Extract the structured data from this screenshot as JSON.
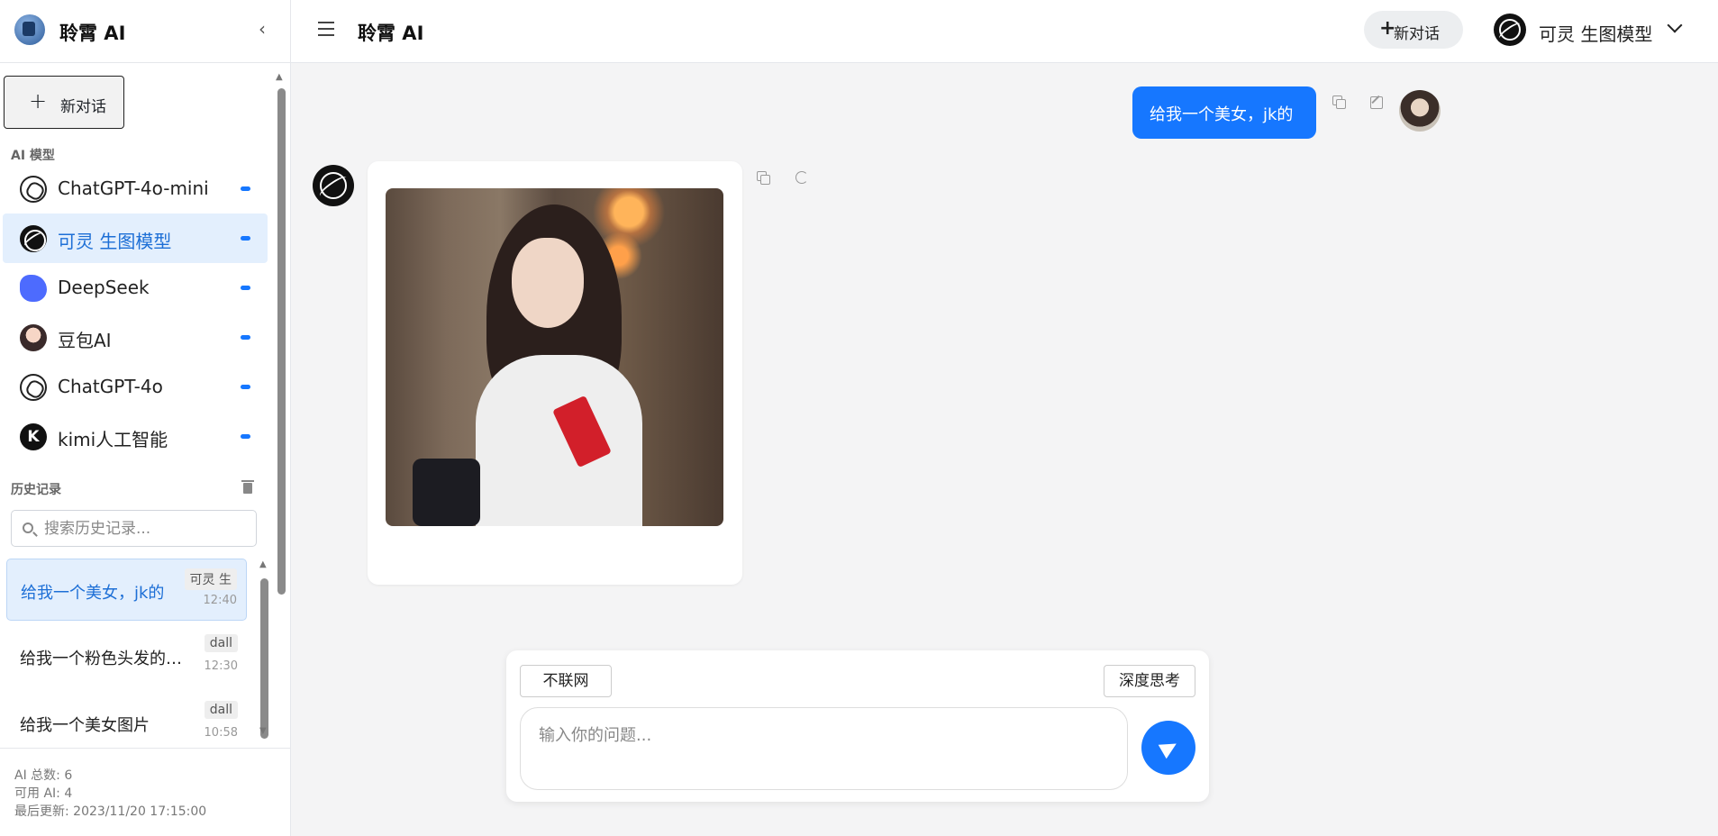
{
  "sidebar": {
    "title": "聆霄 AI",
    "new_chat_label": "新对话",
    "models_section_label": "AI 模型",
    "models": [
      {
        "label": "ChatGPT-4o-mini",
        "icon": "openai-icon",
        "active": false
      },
      {
        "label": "可灵 生图模型",
        "icon": "kling-icon",
        "active": true
      },
      {
        "label": "DeepSeek",
        "icon": "deepseek-icon",
        "active": false
      },
      {
        "label": "豆包AI",
        "icon": "doubao-icon",
        "active": false
      },
      {
        "label": "ChatGPT-4o",
        "icon": "openai-icon",
        "active": false
      },
      {
        "label": "kimi人工智能",
        "icon": "kimi-icon",
        "active": false
      }
    ],
    "kimi_letter": "K",
    "history_section_label": "历史记录",
    "search_placeholder": "搜索历史记录...",
    "history": [
      {
        "title": "给我一个美女，jk的",
        "tag": "可灵 生",
        "time": "12:40",
        "active": true
      },
      {
        "title": "给我一个粉色头发的美女",
        "tag": "dall",
        "time": "12:30",
        "active": false
      },
      {
        "title": "给我一个美女图片",
        "tag": "dall",
        "time": "10:58",
        "active": false
      }
    ],
    "footer": {
      "total": "AI 总数: 6",
      "available": "可用 AI: 4",
      "updated": "最后更新: 2023/11/20 17:15:00"
    }
  },
  "topbar": {
    "title": "聆霄 AI",
    "new_chat_label": "新对话",
    "selected_model": "可灵 生图模型"
  },
  "chat": {
    "user_message": "给我一个美女，jk的"
  },
  "composer": {
    "network_toggle": "不联网",
    "deep_think_toggle": "深度思考",
    "placeholder": "输入你的问题..."
  },
  "colors": {
    "accent": "#1677ff",
    "active_bg": "#e3effd"
  }
}
